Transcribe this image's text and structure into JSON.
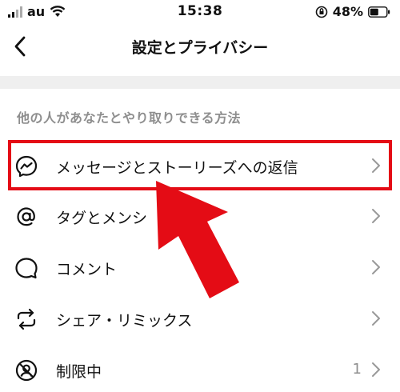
{
  "status_bar": {
    "carrier": "au",
    "time": "15:38",
    "battery": "48%"
  },
  "nav": {
    "title": "設定とプライバシー"
  },
  "section": {
    "header": "他の人があなたとやり取りできる方法"
  },
  "rows": [
    {
      "label": "メッセージとストーリーズへの返信",
      "icon": "messenger-icon"
    },
    {
      "label": "タグとメンシ",
      "icon": "at-sign-icon"
    },
    {
      "label": "コメント",
      "icon": "comment-icon"
    },
    {
      "label": "シェア・リミックス",
      "icon": "share-remix-icon"
    },
    {
      "label": "制限中",
      "icon": "restricted-icon",
      "count": "1"
    }
  ],
  "colors": {
    "highlight": "#e40c15",
    "arrow": "#e40c15",
    "secondary_text": "#8e8e8e",
    "divider": "#efefef"
  }
}
